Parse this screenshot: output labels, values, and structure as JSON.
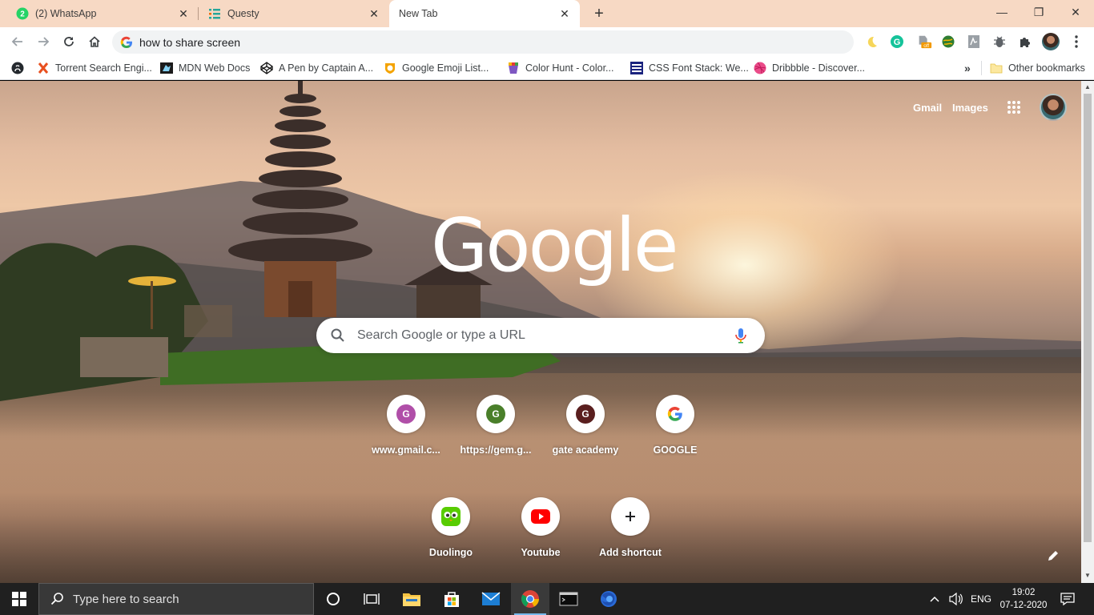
{
  "tabs": [
    {
      "title": "(2) WhatsApp",
      "badge": "2"
    },
    {
      "title": "Questy"
    },
    {
      "title": "New Tab",
      "active": true
    }
  ],
  "window": {
    "minimize": "—",
    "maximize": "❐",
    "close": "✕"
  },
  "omnibox": {
    "value": "how to share screen"
  },
  "bookmarks": [
    {
      "label": "Torrent Search Engi..."
    },
    {
      "label": "MDN Web Docs"
    },
    {
      "label": "A Pen by Captain A..."
    },
    {
      "label": "Google Emoji List..."
    },
    {
      "label": "Color Hunt - Color..."
    },
    {
      "label": "CSS Font Stack: We..."
    },
    {
      "label": "Dribbble - Discover..."
    }
  ],
  "bookmarks_more": "»",
  "other_bookmarks": "Other bookmarks",
  "ntp": {
    "gmail": "Gmail",
    "images": "Images",
    "logo": "Google",
    "search_placeholder": "Search Google or type a URL",
    "shortcuts": [
      {
        "label": "www.gmail.c...",
        "letter": "G",
        "color": "#b04fa8"
      },
      {
        "label": "https://gem.g...",
        "letter": "G",
        "color": "#4a7f2a"
      },
      {
        "label": "gate academy",
        "letter": "G",
        "color": "#5a1f1f"
      },
      {
        "label": "GOOGLE",
        "icon": "google-g-icon"
      },
      {
        "label": "Duolingo",
        "icon": "duolingo-owl-icon"
      },
      {
        "label": "Youtube",
        "icon": "youtube-icon"
      },
      {
        "label": "Add shortcut",
        "icon": "plus-icon"
      }
    ]
  },
  "extensions": {
    "off_badge": "off"
  },
  "taskbar": {
    "search_placeholder": "Type here to search",
    "language": "ENG",
    "time": "19:02",
    "date": "07-12-2020"
  }
}
